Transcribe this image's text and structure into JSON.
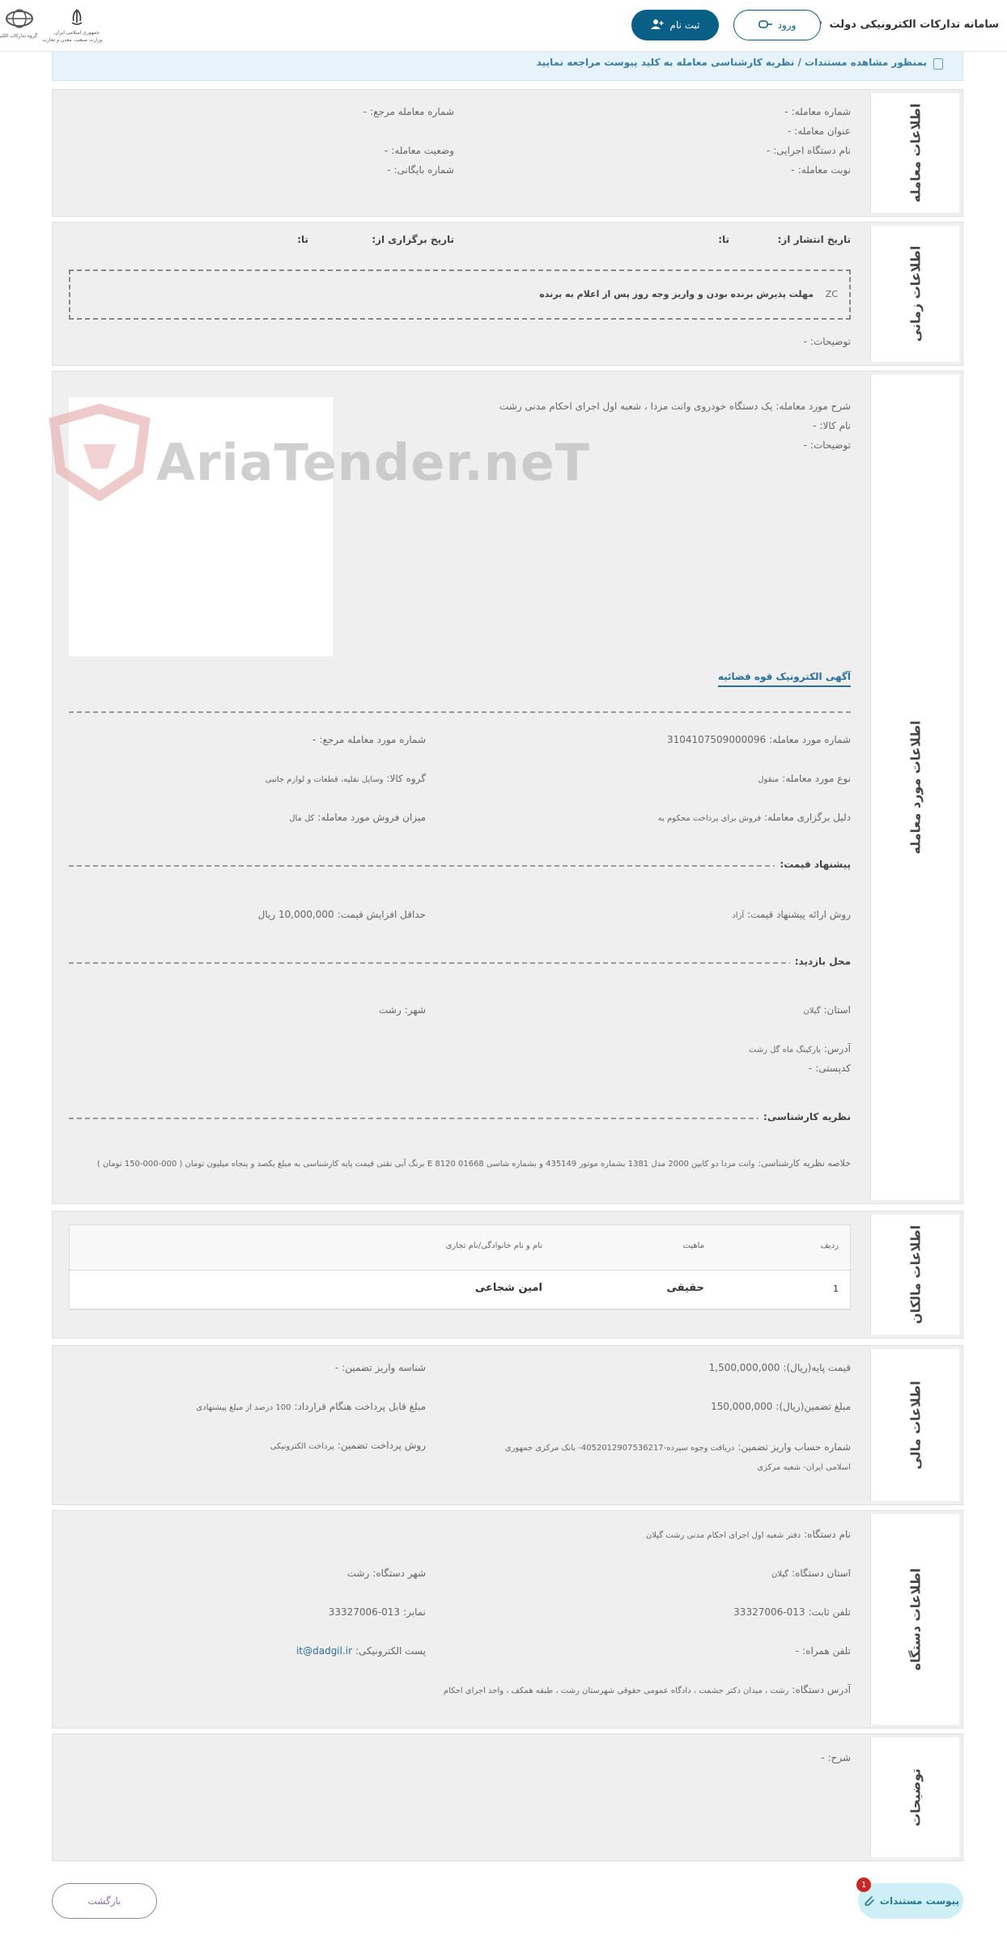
{
  "header": {
    "title": "سامانه تدارکات الکترونیکی دولت",
    "login_label": "ورود",
    "register_label": "ثبت نام",
    "gov_logo1_caption_top": "جمهوری اسلامی ایران",
    "gov_logo1_caption": "وزارت صنعت، معدن و تجارت",
    "gov_logo2_caption": "گروه تدارکات الکترونیکی"
  },
  "notice": {
    "text": "بمنظور مشاهده مستندات / نظریه کارشناسی معامله به کلید پیوست مراجعه نمایید"
  },
  "deal_info": {
    "title": "اطلاعات معامله",
    "deal_number_label": "شماره معامله:",
    "deal_number": "-",
    "ref_number_label": "شماره معامله مرجع:",
    "ref_number": "-",
    "deal_title_label": "عنوان معامله:",
    "deal_title": "-",
    "executor_label": "نام دستگاه اجرایی:",
    "executor": "-",
    "status_label": "وضعیت معامله:",
    "status": "-",
    "turn_label": "نوبت معامله:",
    "turn": "-",
    "archive_label": "شماره بایگانی:",
    "archive": "-"
  },
  "time_info": {
    "title": "اطلاعات زمانی",
    "publish_from_label": "تاریخ انتشار از:",
    "publish_to_label": "تا:",
    "held_from_label": "تاریخ برگزاری از:",
    "held_to_label": "تا:",
    "deadline_code": "ZC",
    "deadline_text": "مهلت پذیرش برنده بودن و واریز وجه روز پس از اعلام به برنده",
    "desc_label": "توضیحات:",
    "desc": "-"
  },
  "item_info": {
    "title": "اطلاعات مورد معامله",
    "desc_label": "شرح مورد معامله:",
    "desc": "یک دستگاه خودروی وانت مزدا ، شعبه اول اجرای احکام مدنی رشت",
    "goods_label": "نام کالا:",
    "goods": "-",
    "notes_label": "توضیحات:",
    "notes": "-",
    "ad_link": "آگهی الکترونیک قوه قضائیه",
    "item_number_label": "شماره مورد معامله:",
    "item_number": "3104107509000096",
    "item_ref_label": "شماره مورد معامله مرجع:",
    "item_ref": "-",
    "type_label": "نوع مورد معامله:",
    "type": "منقول",
    "group_label": "گروه کالا:",
    "group": "وسایل نقلیه، قطعات و لوازم جانبی",
    "reason_label": "دلیل برگزاری معامله:",
    "reason": "فروش برای پرداخت محکوم به",
    "share_label": "میزان فروش مورد معامله:",
    "share": "کل مال",
    "price_head": "پیشنهاد قیمت:",
    "method_label": "روش ارائه پیشنهاد قیمت:",
    "method": "آزاد",
    "min_inc_label": "حداقل افزایش قیمت:",
    "min_inc": "10,000,000 ریال",
    "visit_head": "محل بازدید:",
    "province_label": "استان:",
    "province": "گیلان",
    "city_label": "شهر:",
    "city": "رشت",
    "address_label": "آدرس:",
    "address": "پارکینگ ماه گل رشت",
    "postal_label": "کدپستی:",
    "postal": "-",
    "expert_head": "نظریه کارشناسی:",
    "expert_label": "خلاصه نظریه کارشناسی:",
    "expert": "وانت مزدا دو کابین 2000 مدل 1381 بشماره موتور 435149 و بشماره شاسی E 8120 01668 برنگ آبی نقتی قیمت پایه کارشناسی به مبلغ یکصد و پنجاه میلیون تومان ( 000-000-150 تومان )",
    "watermark": "AriaTender.neT"
  },
  "owners": {
    "title": "اطلاعات مالکان",
    "col_row": "ردیف",
    "col_nature": "ماهیت",
    "col_name": "نام و نام خانوادگی/نام تجاری",
    "rows": [
      {
        "row": "1",
        "nature": "حقیقی",
        "name": "امین شجاعی"
      }
    ]
  },
  "finance": {
    "title": "اطلاعات مالی",
    "base_price_label": "قیمت پایه(ریال):",
    "base_price": "1,500,000,000",
    "deposit_id_label": "شناسه واریز تضمین:",
    "deposit_id": "-",
    "guarantee_label": "مبلغ تضمین(ریال):",
    "guarantee": "150,000,000",
    "payable_label": "مبلغ قابل پرداخت هنگام قرارداد:",
    "payable": "100 درصد از مبلغ پیشنهادی",
    "account_label": "شماره حساب واریز تضمین:",
    "account": "دریافت وجوه سپرده-4052012907536217- بانک مرکزی جمهوری اسلامی ایران- شعبه مرکزی",
    "pay_method_label": "روش پرداخت تضمین:",
    "pay_method": "پرداخت الکترونیکی"
  },
  "org": {
    "title": "اطلاعات دستگاه",
    "name_label": "نام دستگاه:",
    "name": "دفتر شعبه اول اجرای احکام مدنی رشت گیلان",
    "province_label": "استان دستگاه:",
    "province": "گیلان",
    "city_label": "شهر دستگاه:",
    "city": "رشت",
    "phone_label": "تلفن ثابت:",
    "phone": "013-33327006",
    "fax_label": "نمابر:",
    "fax": "013-33327006",
    "mobile_label": "تلفن همراه:",
    "mobile": "-",
    "email_label": "پست الکترونیکی:",
    "email": "it@dadgil.ir",
    "address_label": "آدرس دستگاه:",
    "address": "رشت ، میدان دکتر حشمت ، دادگاه عمومی حقوقی شهرستان رشت ، طبقه همکف ، واحد اجرای احکام"
  },
  "notes": {
    "title": "توضیحات",
    "desc_label": "شرح:",
    "desc": "-"
  },
  "footer": {
    "back_label": "بازگشت",
    "attach_label": "پیوست مستندات",
    "attach_count": "1"
  }
}
